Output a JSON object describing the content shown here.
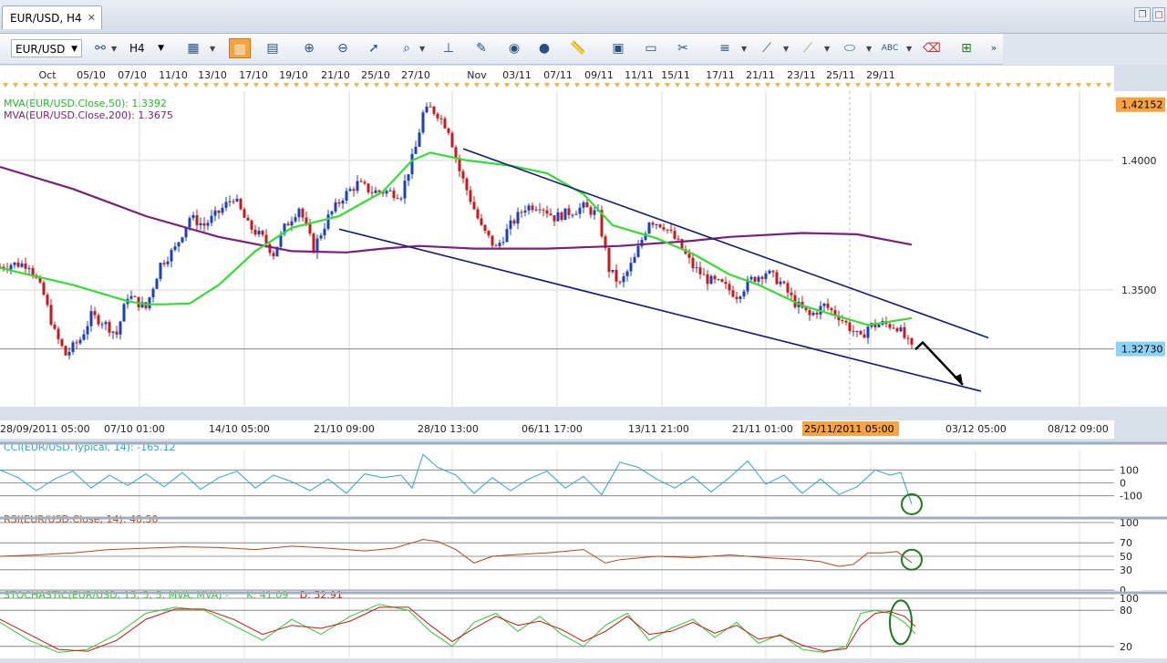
{
  "tab": {
    "title": "EUR/USD, H4",
    "close": "✕"
  },
  "toolbar": {
    "symbol": "EUR/USD",
    "timeframe": "H4"
  },
  "top_dates": [
    "Oct",
    "05/10",
    "07/10",
    "11/10",
    "13/10",
    "17/10",
    "19/10",
    "21/10",
    "25/10",
    "27/10",
    "Nov",
    "03/11",
    "07/11",
    "09/11",
    "11/11",
    "15/11",
    "17/11",
    "21/11",
    "23/11",
    "25/11",
    "29/11"
  ],
  "bottom_dates": [
    "28/09/2011 05:00",
    "07/10 01:00",
    "14/10 05:00",
    "21/10 09:00",
    "28/10 13:00",
    "06/11 17:00",
    "13/11 21:00",
    "21/11 01:00",
    "25/11/2011 05:00",
    "03/12 05:00",
    "08/12 09:00"
  ],
  "colors": {
    "ma50": "#33dd33",
    "ma200": "#7a1f7a",
    "up": "#1a3fc2",
    "down": "#c81a1a",
    "cci": "#2aa6d8",
    "rsi": "#b0481a",
    "stochK": "#2ccc2c",
    "stochD": "#cc1414",
    "channel": "#101a7a",
    "highlight": "#f6a340"
  },
  "chart_data": [
    {
      "type": "line",
      "title": "",
      "legend": [
        {
          "label": "MVA(EUR/USD.Close,50): 1.3392",
          "color": "#22bb22"
        },
        {
          "label": "MVA(EUR/USD.Close,200): 1.3675",
          "color": "#7a1f7a"
        }
      ],
      "yticks": [
        1.35,
        1.4
      ],
      "ytick_labels": [
        "1.3500",
        "1.4000"
      ],
      "ylim": [
        1.305,
        1.4267
      ],
      "xlim": [
        0,
        244
      ],
      "price_badges": [
        {
          "label": "1.42152",
          "value": 1.42152,
          "color": "#f6a340"
        },
        {
          "label": "1.32730",
          "value": 1.3273,
          "color": "#8fd3f4"
        }
      ],
      "series": [
        {
          "name": "MVA 50",
          "x": [
            0,
            20,
            35,
            40,
            45,
            52,
            60,
            70,
            80,
            93,
            105,
            113,
            118,
            128,
            140,
            150,
            160,
            168,
            180,
            190,
            200,
            208,
            220,
            238,
            250
          ],
          "y": [
            1.3585,
            1.352,
            1.3457,
            1.3445,
            1.3445,
            1.3448,
            1.352,
            1.365,
            1.374,
            1.3785,
            1.388,
            1.4,
            1.403,
            1.4,
            1.398,
            1.395,
            1.387,
            1.375,
            1.37,
            1.364,
            1.356,
            1.352,
            1.344,
            1.3365,
            1.3392
          ]
        },
        {
          "name": "MVA 200",
          "x": [
            0,
            20,
            40,
            60,
            80,
            95,
            105,
            115,
            130,
            150,
            170,
            190,
            200,
            220,
            235,
            250
          ],
          "y": [
            1.3975,
            1.389,
            1.3785,
            1.3705,
            1.365,
            1.3645,
            1.366,
            1.367,
            1.366,
            1.366,
            1.367,
            1.369,
            1.3705,
            1.372,
            1.3715,
            1.3675
          ]
        },
        {
          "name": "Close",
          "x": [
            0,
            3,
            8,
            12,
            15,
            18,
            22,
            25,
            28,
            32,
            35,
            40,
            44,
            48,
            52,
            56,
            60,
            64,
            68,
            72,
            75,
            78,
            82,
            86,
            90,
            94,
            98,
            102,
            106,
            110,
            114,
            116,
            118,
            120,
            123,
            126,
            129,
            132,
            136,
            140,
            144,
            148,
            152,
            156,
            160,
            164,
            167,
            170,
            174,
            178,
            182,
            186,
            190,
            194,
            198,
            202,
            206,
            210,
            214,
            218,
            222,
            226,
            230,
            234,
            236,
            238,
            242,
            246,
            250
          ],
          "y": [
            1.359,
            1.36,
            1.36,
            1.348,
            1.3335,
            1.325,
            1.331,
            1.34,
            1.338,
            1.333,
            1.348,
            1.343,
            1.36,
            1.366,
            1.378,
            1.375,
            1.38,
            1.386,
            1.375,
            1.37,
            1.364,
            1.374,
            1.382,
            1.366,
            1.378,
            1.386,
            1.391,
            1.388,
            1.388,
            1.387,
            1.405,
            1.418,
            1.42,
            1.418,
            1.412,
            1.396,
            1.385,
            1.374,
            1.366,
            1.375,
            1.382,
            1.383,
            1.378,
            1.38,
            1.382,
            1.379,
            1.358,
            1.352,
            1.362,
            1.377,
            1.375,
            1.368,
            1.359,
            1.354,
            1.352,
            1.348,
            1.354,
            1.357,
            1.353,
            1.345,
            1.34,
            1.344,
            1.34,
            1.334,
            1.331,
            1.336,
            1.337,
            1.336,
            1.3273
          ]
        }
      ],
      "annotations": [
        {
          "type": "channel_upper",
          "x": [
            127,
            271
          ],
          "y": [
            1.4045,
            1.3316
          ]
        },
        {
          "type": "channel_lower",
          "x": [
            93,
            269
          ],
          "y": [
            1.3735,
            1.311
          ]
        },
        {
          "type": "arrow",
          "x": [
            251,
            253,
            264
          ],
          "y": [
            1.3271,
            1.3298,
            1.3135
          ]
        }
      ]
    },
    {
      "type": "line",
      "legend": [
        {
          "label": "CCI(EUR/USD.Typical, 14): -165.12",
          "color": "#2aa6d8"
        }
      ],
      "ytick_labels": [
        "100",
        "0",
        "-100"
      ],
      "yticks": [
        100,
        0,
        -100
      ],
      "ylim": [
        -250,
        250
      ],
      "xlim": [
        0,
        244
      ],
      "series": [
        {
          "name": "CCI",
          "x": [
            0,
            5,
            10,
            15,
            20,
            25,
            30,
            35,
            40,
            45,
            50,
            55,
            60,
            65,
            70,
            75,
            80,
            85,
            90,
            95,
            100,
            105,
            110,
            113,
            116,
            120,
            125,
            130,
            135,
            140,
            145,
            150,
            155,
            160,
            165,
            170,
            175,
            180,
            185,
            190,
            195,
            200,
            205,
            210,
            215,
            220,
            225,
            230,
            235,
            240,
            244,
            247,
            250
          ],
          "y": [
            100,
            40,
            -60,
            30,
            90,
            -40,
            60,
            -20,
            70,
            -30,
            80,
            -50,
            40,
            90,
            -40,
            60,
            10,
            -60,
            30,
            -80,
            70,
            40,
            60,
            -40,
            220,
            120,
            60,
            -80,
            40,
            -60,
            30,
            90,
            -40,
            50,
            -90,
            160,
            120,
            30,
            -40,
            50,
            -70,
            40,
            170,
            -10,
            60,
            -80,
            30,
            -90,
            -30,
            100,
            60,
            80,
            -165
          ]
        }
      ],
      "markers": [
        {
          "type": "circle",
          "x": 250,
          "y": -165
        }
      ]
    },
    {
      "type": "line",
      "legend": [
        {
          "label": "RSI(EUR/USD.Close, 14): 40.50",
          "color": "#b0481a"
        }
      ],
      "ytick_labels": [
        "100",
        "70",
        "50",
        "30",
        "0"
      ],
      "yticks": [
        100,
        70,
        50,
        30,
        0
      ],
      "ylim": [
        0,
        100
      ],
      "xlim": [
        0,
        244
      ],
      "series": [
        {
          "name": "RSI",
          "x": [
            0,
            10,
            20,
            30,
            40,
            50,
            60,
            70,
            80,
            90,
            100,
            108,
            113,
            116,
            120,
            125,
            130,
            135,
            140,
            150,
            160,
            166,
            170,
            180,
            190,
            200,
            210,
            220,
            225,
            230,
            234,
            238,
            242,
            246,
            250
          ],
          "y": [
            50,
            52,
            55,
            60,
            62,
            64,
            63,
            60,
            65,
            62,
            58,
            62,
            70,
            75,
            72,
            60,
            40,
            50,
            52,
            55,
            60,
            40,
            45,
            50,
            48,
            52,
            48,
            45,
            42,
            35,
            38,
            55,
            55,
            57,
            40.5
          ]
        }
      ],
      "markers": [
        {
          "type": "circle",
          "x": 250,
          "y": 45
        }
      ]
    },
    {
      "type": "line",
      "legend": [
        {
          "label": "STOCHASTIC(EUR/USD, 15, 5, 5, MVA, MVA) -",
          "color": "#2ccc2c"
        },
        {
          "label": "K: 41.09",
          "color": "#2ccc2c"
        },
        {
          "label": "D: 52.91",
          "color": "#cc1414"
        }
      ],
      "ytick_labels": [
        "100",
        "80",
        "20"
      ],
      "yticks": [
        100,
        80,
        20
      ],
      "ylim": [
        0,
        100
      ],
      "xlim": [
        0,
        244
      ],
      "series": [
        {
          "name": "K",
          "x": [
            0,
            8,
            16,
            24,
            32,
            40,
            48,
            56,
            64,
            72,
            80,
            88,
            96,
            104,
            112,
            118,
            124,
            130,
            136,
            142,
            148,
            154,
            160,
            166,
            172,
            178,
            184,
            190,
            196,
            202,
            208,
            214,
            220,
            226,
            232,
            236,
            240,
            244,
            248,
            251
          ],
          "y": [
            60,
            30,
            10,
            15,
            40,
            75,
            85,
            80,
            55,
            30,
            65,
            40,
            70,
            90,
            80,
            45,
            20,
            60,
            75,
            45,
            70,
            40,
            20,
            55,
            75,
            30,
            50,
            65,
            35,
            60,
            25,
            40,
            15,
            10,
            20,
            75,
            80,
            75,
            60,
            41
          ]
        },
        {
          "name": "D",
          "x": [
            0,
            8,
            16,
            24,
            32,
            40,
            48,
            56,
            64,
            72,
            80,
            88,
            96,
            104,
            112,
            118,
            124,
            130,
            136,
            142,
            148,
            154,
            160,
            166,
            172,
            178,
            184,
            190,
            196,
            202,
            208,
            214,
            220,
            226,
            232,
            236,
            240,
            244,
            248,
            251
          ],
          "y": [
            65,
            40,
            15,
            12,
            30,
            65,
            82,
            82,
            65,
            40,
            55,
            50,
            62,
            85,
            85,
            55,
            28,
            50,
            70,
            55,
            62,
            48,
            28,
            45,
            70,
            40,
            45,
            60,
            42,
            55,
            32,
            38,
            22,
            12,
            16,
            55,
            75,
            78,
            70,
            53
          ]
        }
      ],
      "markers": [
        {
          "type": "ellipse",
          "x": 249,
          "y": 60
        }
      ]
    }
  ]
}
